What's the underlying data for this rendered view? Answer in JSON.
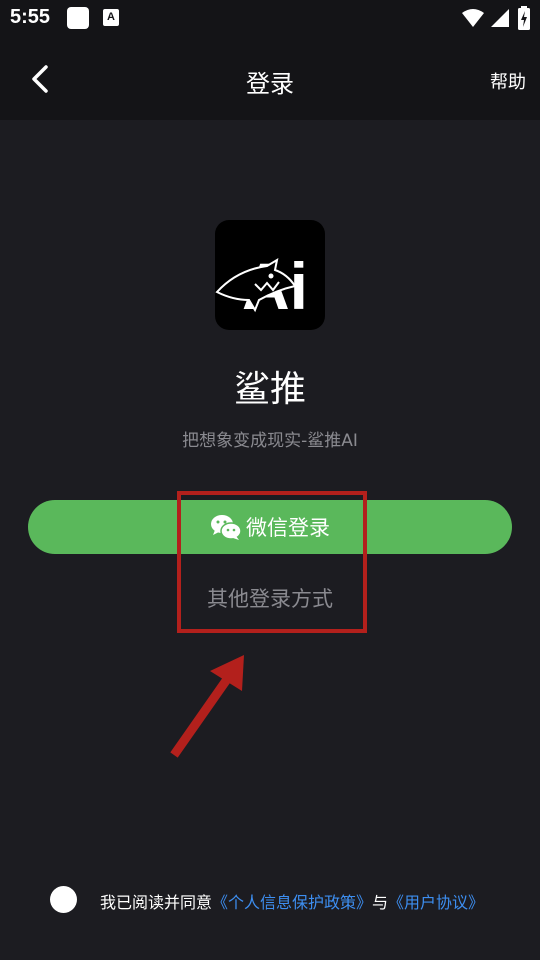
{
  "status_bar": {
    "time": "5:55",
    "notification_letter": "A"
  },
  "header": {
    "title": "登录",
    "help_label": "帮助"
  },
  "app": {
    "logo_text": "Ai",
    "name": "鲨推",
    "slogan": "把想象变成现实-鲨推AI"
  },
  "login": {
    "wechat_label": "微信登录",
    "other_label": "其他登录方式"
  },
  "agreement": {
    "prefix": "我已阅读并同意",
    "privacy_link": "《个人信息保护政策》",
    "connector": "与",
    "terms_link": "《用户协议》"
  },
  "colors": {
    "background": "#1c1c21",
    "header_bg": "#141417",
    "wechat_green": "#5ab85b",
    "link_blue": "#3d8ef0",
    "annotation_red": "#b3201c",
    "muted_text": "#8a8a90"
  },
  "icons": {
    "back": "chevron-left-icon",
    "wechat": "wechat-icon",
    "wifi": "wifi-icon",
    "signal": "signal-icon",
    "battery": "battery-charging-icon"
  }
}
